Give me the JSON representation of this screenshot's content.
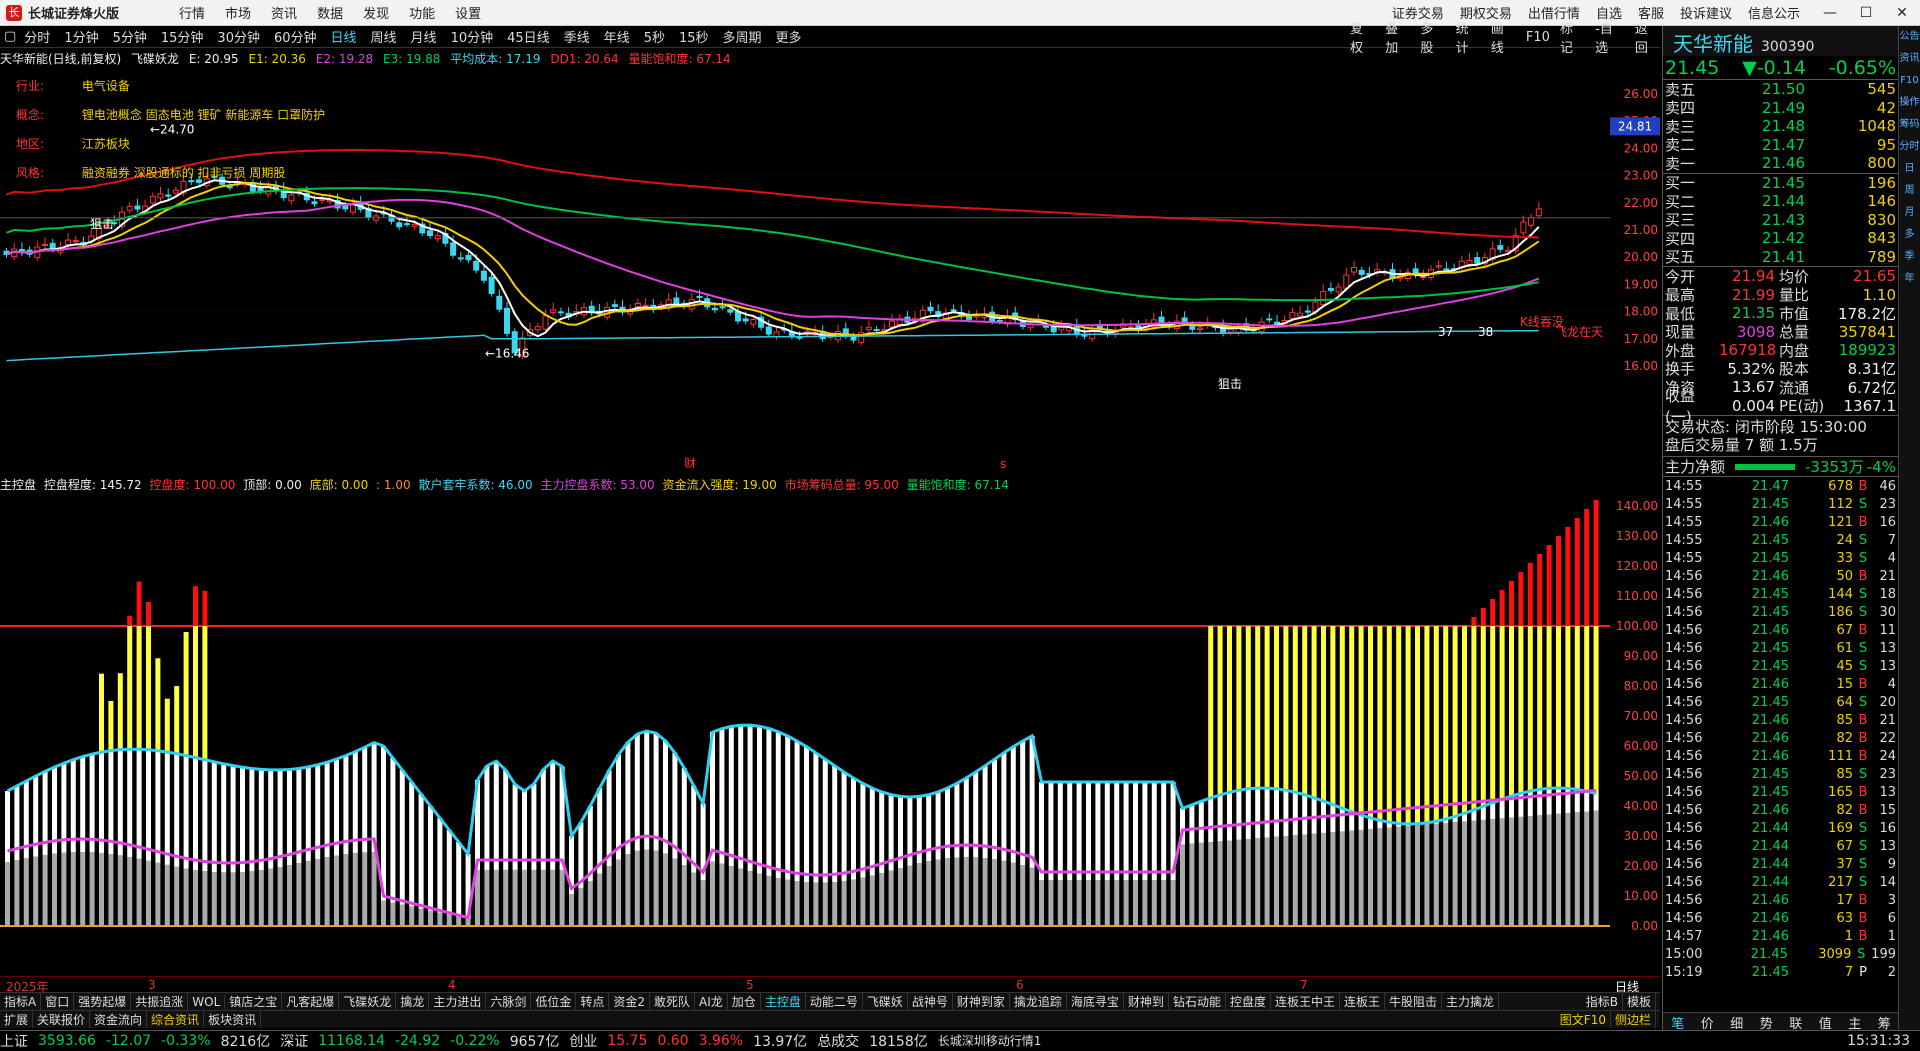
{
  "titlebar": {
    "app": "长城证券烽火版",
    "menus": [
      "行情",
      "市场",
      "资讯",
      "数据",
      "发现",
      "功能",
      "设置"
    ],
    "right_links": [
      "证券交易",
      "期权交易",
      "出借行情",
      "自选",
      "客服",
      "投诉建议",
      "信息公示"
    ]
  },
  "periods": [
    "分时",
    "1分钟",
    "5分钟",
    "15分钟",
    "30分钟",
    "60分钟",
    "日线",
    "周线",
    "月线",
    "10分钟",
    "45日线",
    "季线",
    "年线",
    "5秒",
    "15秒",
    "多周期",
    "更多"
  ],
  "active_period": "日线",
  "tools": [
    "复权",
    "叠加",
    "多股",
    "统计",
    "画线",
    "F10",
    "标记",
    "-自选",
    "返回"
  ],
  "chart_info": {
    "name": "天华新能(日线,前复权)",
    "indicator": "飞碟妖龙",
    "E": "E: 20.95",
    "E1": "E1: 20.36",
    "E2": "E2: 19.28",
    "E3": "E3: 19.88",
    "avgcost": "平均成本: 17.19",
    "DD1": "DD1: 20.64",
    "vol": "量能饱和度: 67.14"
  },
  "profile": {
    "industry_label": "行业:",
    "industry": "电气设备",
    "concept_label": "概念:",
    "concept": "锂电池概念 固态电池 锂矿 新能源车 口罩防护",
    "region_label": "地区:",
    "region": "江苏板块",
    "style_label": "风格:",
    "style": "融资融券 深股通标的 扣非亏损 周期股"
  },
  "annotations": {
    "high": "24.70",
    "low": "16.46",
    "mark1": "狙击",
    "mark2": "狙击",
    "c37": "37",
    "c38": "38",
    "sig1": "K线吞没",
    "sig2": "飞龙在天",
    "cai": "财",
    "s": "s"
  },
  "price_axis": {
    "labels": [
      "26.00",
      "25.00",
      "24.00",
      "23.00",
      "22.00",
      "21.00",
      "20.00",
      "19.00",
      "18.00",
      "17.00",
      "16.00"
    ],
    "current": "24.81"
  },
  "sub_info": {
    "name": "主控盘",
    "ctrl": "控盘程度: 145.72",
    "ctrl2": "控盘度: 100.00",
    "top": "顶部: 0.00",
    "bottom": "底部: 0.00",
    "one": ": 1.00",
    "retail": "散户套牢系数: 46.00",
    "main": "主力控盘系数: 53.00",
    "inflow": "资金流入强度: 19.00",
    "chips": "市场筹码总量: 95.00",
    "vol": "量能饱和度: 67.14"
  },
  "sub_axis": [
    "140.00",
    "130.00",
    "120.00",
    "110.00",
    "100.00",
    "90.00",
    "80.00",
    "70.00",
    "60.00",
    "50.00",
    "40.00",
    "30.00",
    "20.00",
    "10.00",
    "0.00"
  ],
  "dates": [
    "2025年",
    "3",
    "4",
    "5",
    "6",
    "7"
  ],
  "date_right": "日线",
  "indicator_tabs": [
    "指标A",
    "窗口",
    "强势起爆",
    "共振追涨",
    "WOL",
    "镇店之宝",
    "凡客起爆",
    "飞碟妖龙",
    "擒龙",
    "主力进出",
    "六脉剑",
    "低位金",
    "转点",
    "资金2",
    "敢死队",
    "AI龙",
    "加仓",
    "主控盘",
    "动能二号",
    "飞碟妖",
    "战神号",
    "财神到家",
    "擒龙追踪",
    "海底寻宝",
    "财神到",
    "钻石动能",
    "控盘度",
    "连板王中王",
    "连板王",
    "牛股阻击",
    "主力擒龙"
  ],
  "indicator_tabs_right": [
    "指标B",
    "模板"
  ],
  "active_indicator": "主控盘",
  "tabs2": [
    "扩展",
    "关联报价",
    "资金流向",
    "综合资讯",
    "板块资讯"
  ],
  "active_tab2": "综合资讯",
  "tabs2_right": [
    "图文F10",
    "侧边栏"
  ],
  "quote": {
    "name": "天华新能",
    "code": "300390",
    "price": "21.45",
    "change": "▼-0.14",
    "pct": "-0.65%",
    "asks": [
      {
        "l": "卖五",
        "p": "21.50",
        "v": "545"
      },
      {
        "l": "卖四",
        "p": "21.49",
        "v": "42"
      },
      {
        "l": "卖三",
        "p": "21.48",
        "v": "1048"
      },
      {
        "l": "卖二",
        "p": "21.47",
        "v": "95"
      },
      {
        "l": "卖一",
        "p": "21.46",
        "v": "800"
      }
    ],
    "bids": [
      {
        "l": "买一",
        "p": "21.45",
        "v": "196"
      },
      {
        "l": "买二",
        "p": "21.44",
        "v": "146"
      },
      {
        "l": "买三",
        "p": "21.43",
        "v": "830"
      },
      {
        "l": "买四",
        "p": "21.42",
        "v": "843"
      },
      {
        "l": "买五",
        "p": "21.41",
        "v": "789"
      }
    ],
    "stats": [
      [
        "今开",
        "21.94",
        "均价",
        "21.65"
      ],
      [
        "最高",
        "21.99",
        "量比",
        "1.10"
      ],
      [
        "最低",
        "21.35",
        "市值",
        "178.2亿"
      ],
      [
        "现量",
        "3098",
        "总量",
        "357841"
      ],
      [
        "外盘",
        "167918",
        "内盘",
        "189923"
      ],
      [
        "换手",
        "5.32%",
        "股本",
        "8.31亿"
      ],
      [
        "净资",
        "13.67",
        "流通",
        "6.72亿"
      ],
      [
        "收益(一)",
        "0.004",
        "PE(动)",
        "1367.1"
      ]
    ],
    "state": "交易状态: 闭市阶段 15:30:00",
    "after": "盘后交易量 7 额 1.5万",
    "netflow_label": "主力净额",
    "netflow": "-3353万",
    "netpct": "-4%"
  },
  "ticks": [
    [
      "14:55",
      "21.47",
      "678",
      "B",
      "46"
    ],
    [
      "14:55",
      "21.45",
      "112",
      "S",
      "23"
    ],
    [
      "14:55",
      "21.46",
      "121",
      "B",
      "16"
    ],
    [
      "14:55",
      "21.45",
      "24",
      "S",
      "7"
    ],
    [
      "14:55",
      "21.45",
      "33",
      "S",
      "4"
    ],
    [
      "14:56",
      "21.46",
      "50",
      "B",
      "21"
    ],
    [
      "14:56",
      "21.45",
      "144",
      "S",
      "18"
    ],
    [
      "14:56",
      "21.45",
      "186",
      "S",
      "30"
    ],
    [
      "14:56",
      "21.46",
      "67",
      "B",
      "11"
    ],
    [
      "14:56",
      "21.45",
      "61",
      "S",
      "13"
    ],
    [
      "14:56",
      "21.45",
      "45",
      "S",
      "13"
    ],
    [
      "14:56",
      "21.46",
      "15",
      "B",
      "4"
    ],
    [
      "14:56",
      "21.45",
      "64",
      "S",
      "20"
    ],
    [
      "14:56",
      "21.46",
      "85",
      "B",
      "21"
    ],
    [
      "14:56",
      "21.46",
      "82",
      "B",
      "22"
    ],
    [
      "14:56",
      "21.46",
      "111",
      "B",
      "24"
    ],
    [
      "14:56",
      "21.45",
      "85",
      "S",
      "23"
    ],
    [
      "14:56",
      "21.45",
      "165",
      "B",
      "13"
    ],
    [
      "14:56",
      "21.46",
      "82",
      "B",
      "15"
    ],
    [
      "14:56",
      "21.44",
      "169",
      "S",
      "16"
    ],
    [
      "14:56",
      "21.44",
      "67",
      "S",
      "13"
    ],
    [
      "14:56",
      "21.44",
      "37",
      "S",
      "9"
    ],
    [
      "14:56",
      "21.44",
      "217",
      "S",
      "14"
    ],
    [
      "14:56",
      "21.46",
      "17",
      "B",
      "3"
    ],
    [
      "14:56",
      "21.46",
      "63",
      "B",
      "6"
    ],
    [
      "14:57",
      "21.46",
      "1",
      "B",
      "1"
    ],
    [
      "15:00",
      "21.45",
      "3099",
      "S",
      "199"
    ],
    [
      "15:19",
      "21.45",
      "7",
      "P",
      "2"
    ]
  ],
  "quote_tabs": [
    "笔",
    "价",
    "细",
    "势",
    "联",
    "值",
    "主",
    "筹"
  ],
  "sidebar": [
    "公告",
    "资讯",
    "F10",
    "操作",
    "筹码",
    "分时",
    "日",
    "周",
    "月",
    "多",
    "季",
    "年"
  ],
  "status": {
    "sh": "上证",
    "sh_v": "3593.66",
    "sh_c": "-12.07",
    "sh_p": "-0.33%",
    "sh_a": "8216亿",
    "sz": "深证",
    "sz_v": "11168.14",
    "sz_c": "-24.92",
    "sz_p": "-0.22%",
    "sz_a": "9657亿",
    "cy": "创业",
    "cy_v": "15.75",
    "cy_c": "0.60",
    "cy_p": "3.96%",
    "cy_a": "13.97亿",
    "total": "总成交",
    "total_v": "18158亿",
    "feed": "长城深圳移动行情1",
    "time": "15:31:33"
  },
  "colors": {
    "up": "#ff3333",
    "down": "#3ad7f0",
    "ma1": "#ffffff",
    "ma2": "#f0d000",
    "ma3": "#e040e0",
    "ma4": "#00c040",
    "ma5": "#e01010",
    "ma6": "#30c8e0"
  }
}
